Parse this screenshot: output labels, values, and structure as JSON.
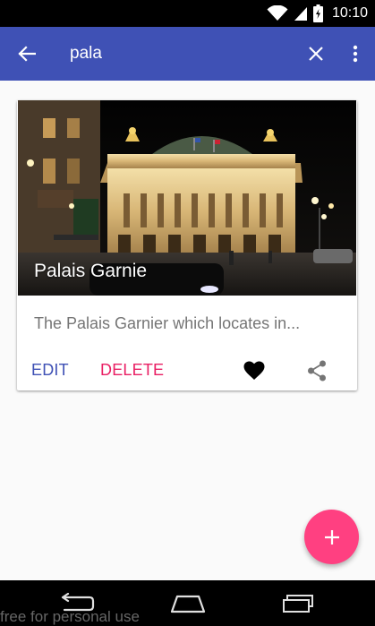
{
  "status_bar": {
    "time": "10:10",
    "icons": [
      "wifi-icon",
      "signal-icon",
      "battery-icon"
    ]
  },
  "search_bar": {
    "query": "pala",
    "back_icon": "arrow-back-icon",
    "clear_icon": "close-icon",
    "more_icon": "more-vert-icon"
  },
  "card": {
    "title": "Palais Garnie",
    "description": "The Palais Garnier which locates in...",
    "edit_label": "EDIT",
    "delete_label": "DELETE",
    "favorite_icon": "heart-icon",
    "share_icon": "share-icon"
  },
  "fab": {
    "icon": "plus-icon",
    "color": "#ff4081"
  },
  "nav_bar": {
    "icons": [
      "nav-back-icon",
      "nav-home-icon",
      "nav-recent-icon"
    ]
  },
  "watermark": "free for personal use",
  "colors": {
    "primary": "#3f51b5",
    "accent": "#ff4081",
    "delete": "#e91e63",
    "status_bar": "#000000"
  }
}
